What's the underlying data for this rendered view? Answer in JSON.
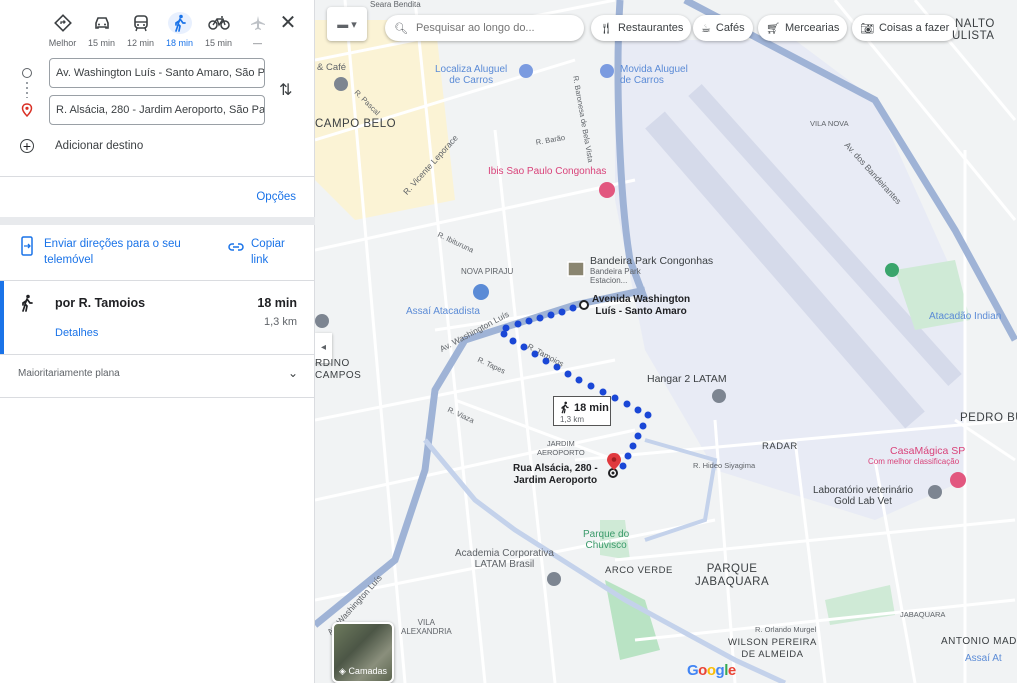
{
  "panel": {
    "modes": [
      {
        "label": "Melhor",
        "icon": "diamond-route-icon",
        "selected": false
      },
      {
        "label": "15 min",
        "icon": "car-icon",
        "selected": false
      },
      {
        "label": "12 min",
        "icon": "transit-icon",
        "selected": false
      },
      {
        "label": "18 min",
        "icon": "walking-icon",
        "selected": true
      },
      {
        "label": "15 min",
        "icon": "bicycle-icon",
        "selected": false
      },
      {
        "label": "—",
        "icon": "airplane-icon",
        "selected": false
      }
    ],
    "origin": "Av. Washington Luís - Santo Amaro, São Paulo",
    "destination": "R. Alsácia, 280 - Jardim Aeroporto, São Paulo",
    "add_destination": "Adicionar destino",
    "options_label": "Opções",
    "send_directions": "Enviar direções para o seu telemóvel",
    "copy_link": "Copiar link",
    "route": {
      "via": "por R. Tamoios",
      "duration": "18 min",
      "distance": "1,3 km",
      "details": "Detalhes"
    },
    "terrain": "Maioritariamente plana"
  },
  "map": {
    "search_placeholder": "Pesquisar ao longo do...",
    "chips": [
      {
        "label": "Restaurantes",
        "icon": "fork-knife-icon"
      },
      {
        "label": "Cafés",
        "icon": "coffee-icon"
      },
      {
        "label": "Mercearias",
        "icon": "cart-icon"
      },
      {
        "label": "Coisas a fazer",
        "icon": "camera-icon"
      }
    ],
    "layers_label": "Camadas",
    "google": [
      "G",
      "o",
      "o",
      "g",
      "l",
      "e"
    ],
    "walk_badge": {
      "time": "18 min",
      "distance": "1,3 km"
    },
    "labels": {
      "campo_belo": "CAMPO BELO",
      "nalto": "NALTO",
      "ulista": "ULISTA",
      "cafe": "& Café",
      "localiza": "Localiza Aluguel\nde Carros",
      "movida": "Movida Aluguel\nde Carros",
      "ibis": "Ibis Sao Paulo Congonhas",
      "bandeira": "Bandeira Park Congonhas",
      "bandeira_sub": "Bandeira Park\nEstacion...",
      "nova_piraju": "NOVA PIRAJU",
      "assai": "Assaí Atacadista",
      "origin_pin": "Avenida Washington\nLuís - Santo Amaro",
      "dest_pin": "Rua Alsácia, 280 -\nJardim Aeroporto",
      "hangar": "Hangar 2 LATAM",
      "radar": "RADAR",
      "pedro_bu": "PEDRO BU",
      "casamagica": "CasaMágica SP",
      "casamagica_sub": "Com melhor classificação",
      "laboratorio": "Laboratório veterinário\nGold Lab Vet",
      "jardim_aeroporto": "JARDIM\nAEROPORTO",
      "parque_chuvisco": "Parque do\nChuvisco",
      "academia": "Academia Corporativa\nLATAM Brasil",
      "arco_verde": "ARCO VERDE",
      "parque_jabaquara": "PARQUE\nJABAQUARA",
      "vila_alexandria": "VILA\nALEXANDRIA",
      "wilson": "WILSON PEREIRA\nDE ALMEIDA",
      "antonio": "ANTONIO MAD",
      "assai2": "Assaí At",
      "atacadao": "Atacadão Indian",
      "vila_nova": "VILA NOVA",
      "rdino": "RDINO\nCAMPOS",
      "jabaquara_st": "JABAQUARA",
      "r_barao": "R. Barão",
      "r_vicente": "R. Vicente Leporace",
      "av_bandeirantes": "Av. dos Bandeirantes",
      "av_wl": "Av. Washington Luís",
      "av_wl2": "Av. Washington Luís",
      "r_tamoios": "R. Tamoios",
      "r_hideo": "R. Hideo Siyagima",
      "r_orlando": "R. Orlando Murgel",
      "r_ibituruna": "R. Ibituruna",
      "r_pascal": "R. Pascal",
      "r_tapes": "R. Tapes",
      "r_vieira": "R. Viaza",
      "seara": "Seara Bendita",
      "r_barao_top": "R. Baronesa de Bela Vista"
    }
  }
}
